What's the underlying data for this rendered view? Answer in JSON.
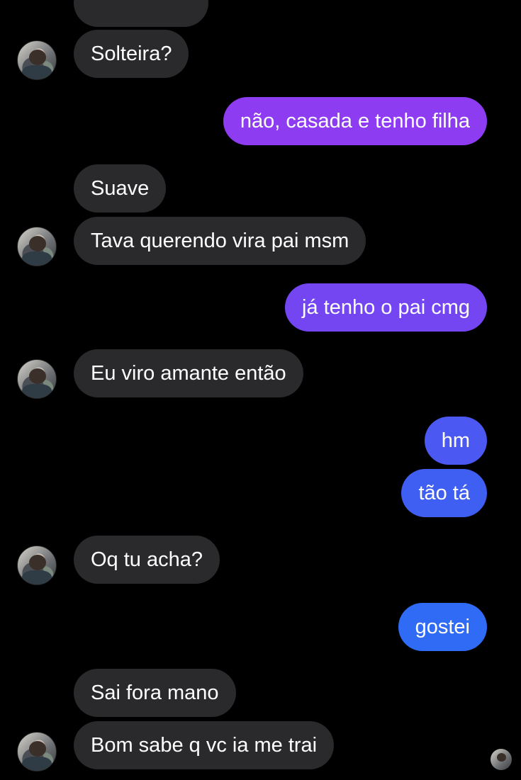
{
  "colors": {
    "background": "#000000",
    "incoming_bubble": "#2a2a2c",
    "outgoing_gradient_top": "#8a3cf0",
    "outgoing_gradient_bottom": "#2f6bf4",
    "text": "#ffffff"
  },
  "contact": {
    "avatar_icon": "contact-avatar-icon"
  },
  "messages": [
    {
      "direction": "in",
      "text": "Solteira?"
    },
    {
      "direction": "out",
      "text": "não, casada e tenho filha"
    },
    {
      "direction": "in",
      "text": "Suave"
    },
    {
      "direction": "in",
      "text": "Tava querendo vira pai msm"
    },
    {
      "direction": "out",
      "text": "já tenho o pai cmg"
    },
    {
      "direction": "in",
      "text": "Eu viro amante então"
    },
    {
      "direction": "out",
      "text": "hm"
    },
    {
      "direction": "out",
      "text": "tão tá"
    },
    {
      "direction": "in",
      "text": "Oq tu acha?"
    },
    {
      "direction": "out",
      "text": "gostei"
    },
    {
      "direction": "in",
      "text": "Sai fora mano"
    },
    {
      "direction": "in",
      "text": "Bom sabe q vc ia me trai"
    }
  ]
}
